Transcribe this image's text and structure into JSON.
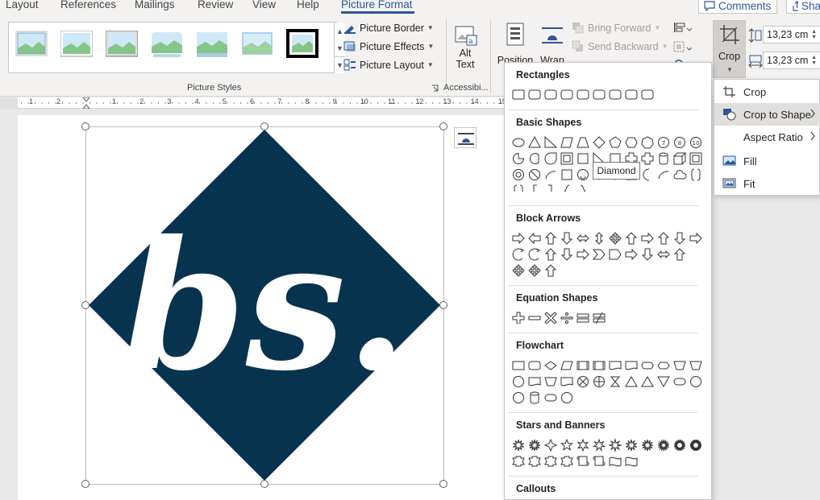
{
  "tabs": [
    {
      "label": "Layout",
      "active": false
    },
    {
      "label": "References",
      "active": false
    },
    {
      "label": "Mailings",
      "active": false
    },
    {
      "label": "Review",
      "active": false
    },
    {
      "label": "View",
      "active": false
    },
    {
      "label": "Help",
      "active": false
    },
    {
      "label": "Picture Format",
      "active": true
    }
  ],
  "top_buttons": {
    "comments": "Comments",
    "share": "Sha"
  },
  "ribbon": {
    "picture_styles_label": "Picture Styles",
    "picture_border": "Picture Border",
    "picture_effects": "Picture Effects",
    "picture_layout": "Picture Layout",
    "alt_text_line1": "Alt",
    "alt_text_line2": "Text",
    "accessibility_label": "Accessibi...",
    "position": "Position",
    "wrap": "Wrap",
    "bring_forward": "Bring Forward",
    "send_backward": "Send Backward",
    "crop": "Crop",
    "height_value": "13,23 cm",
    "width_value": "13,23 cm"
  },
  "ruler": {
    "numbers": [
      "1",
      "2",
      "1",
      "2",
      "3",
      "4",
      "5",
      "6",
      "7",
      "8",
      "9",
      "10",
      "11",
      "12",
      "13",
      "14",
      "15"
    ]
  },
  "document": {
    "logo_text": "bs.",
    "logo_color": "#07334f"
  },
  "shapes_menu": {
    "sections": [
      "Rectangles",
      "Basic Shapes",
      "Block Arrows",
      "Equation Shapes",
      "Flowchart",
      "Stars and Banners",
      "Callouts"
    ],
    "tooltip": "Diamond"
  },
  "crop_menu": {
    "items": [
      {
        "label": "Crop",
        "icon": "crop-icon",
        "has_submenu": false
      },
      {
        "label": "Crop to Shape",
        "icon": "crop-shape-icon",
        "has_submenu": true,
        "highlighted": true
      },
      {
        "label": "Aspect Ratio",
        "icon": "",
        "has_submenu": true
      },
      {
        "label": "Fill",
        "icon": "fill-icon",
        "has_submenu": false
      },
      {
        "label": "Fit",
        "icon": "fit-icon",
        "has_submenu": false
      }
    ]
  },
  "colors": {
    "accent": "#2b579a",
    "highlight": "#e1dfdd",
    "ribbon_bg": "#f3f2f1"
  }
}
